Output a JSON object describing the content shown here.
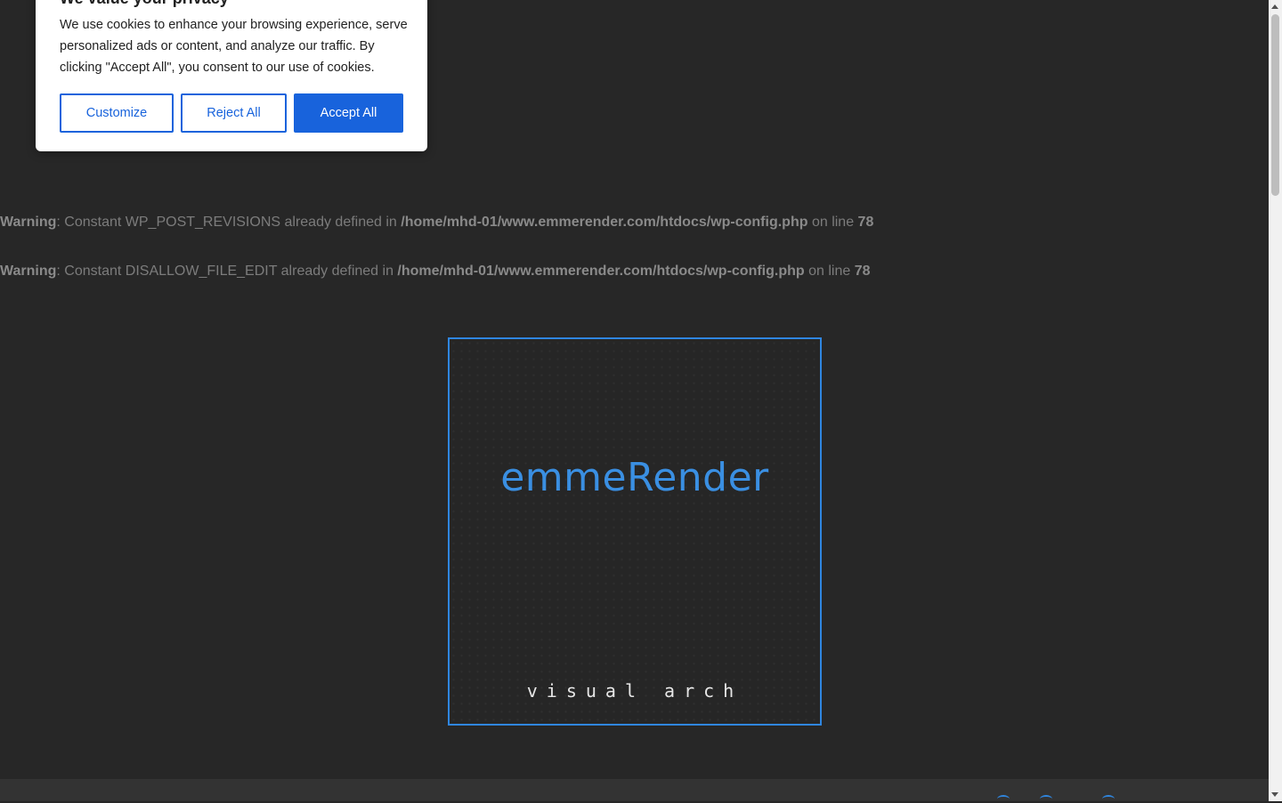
{
  "cookie_banner": {
    "title": "We value your privacy",
    "message": "We use cookies to enhance your browsing experience, serve personalized ads or content, and analyze our traffic. By clicking \"Accept All\", you consent to our use of cookies.",
    "customize_label": "Customize",
    "reject_label": "Reject All",
    "accept_label": "Accept All",
    "accent_color": "#1863dc"
  },
  "warnings": [
    {
      "label": "Warning",
      "text_before": ": Constant WP_POST_REVISIONS already defined in ",
      "path": "/home/mhd-01/www.emmerender.com/htdocs/wp-config.php",
      "text_after": " on line ",
      "line": "78"
    },
    {
      "label": "Warning",
      "text_before": ": Constant DISALLOW_FILE_EDIT already defined in ",
      "path": "/home/mhd-01/www.emmerender.com/htdocs/wp-config.php",
      "text_after": " on line ",
      "line": "78"
    }
  ],
  "logo": {
    "name": "emmeRender",
    "tagline": "visual arch",
    "brand_color": "#2f86e0"
  },
  "page": {
    "background_color": "#272727"
  }
}
